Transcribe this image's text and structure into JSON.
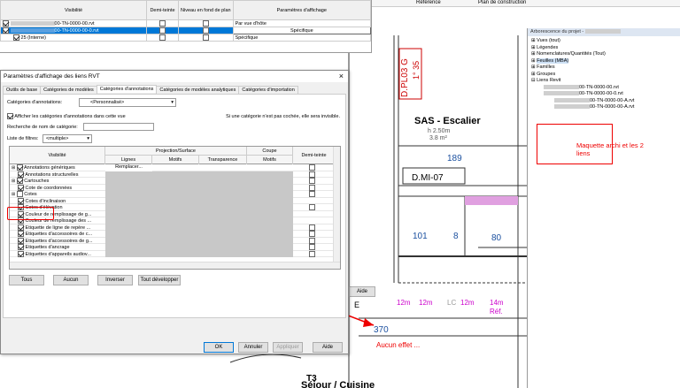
{
  "link_table": {
    "headers": [
      "Visibilité",
      "Demi-teinte",
      "Niveau en fond de plan",
      "Paramètres d'affichage"
    ],
    "rows": [
      {
        "name": "00-TN-0000-00.rvt",
        "setting": "Par vue d'hôte",
        "selected": false,
        "checked": true
      },
      {
        "name": "00-TN-0000-00-0.rvt",
        "setting": "Spécifique",
        "selected": true,
        "checked": true
      },
      {
        "name": "25 (Interne)",
        "setting": "Spécifique",
        "selected": false,
        "checked": true
      }
    ]
  },
  "ribbon": {
    "ref": "Référence",
    "plan": "Plan de construction"
  },
  "browser": {
    "title": "Arborescence du projet -",
    "items": [
      "Vues (tout)",
      "Légendes",
      "Nomenclatures/Quantités (Tout)",
      "Feuilles (MBA)",
      "Familles",
      "Groupes",
      "Liens Revit"
    ],
    "links": [
      "00-TN-0000-00.rvt",
      "00-TN-0000-00-0.rvt",
      "00-TN-0000-00-A.rvt",
      "00-TN-0000-00-A.rvt"
    ]
  },
  "annotation_right": "Maquette archi et les 2 liens",
  "annotation_bottom": "Aucun effet ...",
  "drawing": {
    "room1": "SAS - Escalier",
    "room1_h": "h 2.50m",
    "room1_a": "3.8 m²",
    "n189": "189",
    "dmi": "D.MI-07",
    "n101": "101",
    "n8": "8",
    "n80": "80",
    "dpl": "D.PL03 G",
    "deg": "1° 35",
    "n370": "370",
    "e": "E",
    "d1": "12m",
    "d2": "12m",
    "lc": "LC",
    "d3": "12m",
    "d4": "14m",
    "ref": "Réf.",
    "room2": "Séjour / Cuisine",
    "t3": "T3",
    "aide": "Aide"
  },
  "dialog": {
    "title": "Paramètres d'affichage des liens RVT",
    "close": "×",
    "tabs": [
      "Outils de base",
      "Catégories de modèles",
      "Catégories d'annotations",
      "Catégories de modèles analytiques",
      "Catégories d'importation"
    ],
    "active_tab": 2,
    "cat_label": "Catégories d'annotations:",
    "cat_value": "<Personnalisé>",
    "show_label": "Afficher les catégories d'annotations dans cette vue",
    "hint": "Si une catégorie n'est pas cochée, elle sera invisible.",
    "search_label": "Recherche de nom de catégorie:",
    "filter_label": "Liste de filtres:",
    "filter_value": "<multiple>",
    "col_visibility": "Visibilité",
    "col_proj": "Projection/Surface",
    "col_lines": "Lignes",
    "col_patterns": "Motifs",
    "col_transp": "Transparence",
    "col_cut": "Coupe",
    "col_cutpat": "Motifs",
    "col_half": "Demi-teinte",
    "replace": "Remplacer...",
    "rows": [
      {
        "label": "Annotations génériques",
        "exp": true,
        "on": true,
        "half": true
      },
      {
        "label": "Annotations structurelles",
        "exp": false,
        "on": true,
        "half": true
      },
      {
        "label": "Cartouches",
        "exp": true,
        "on": true,
        "half": true
      },
      {
        "label": "Cote de coordonnées",
        "exp": false,
        "on": true,
        "half": true
      },
      {
        "label": "Cotes",
        "exp": true,
        "on": false,
        "half": true
      },
      {
        "label": "Cotes d'inclinaison",
        "exp": false,
        "on": true,
        "half": false
      },
      {
        "label": "Cotes d'élévation",
        "exp": false,
        "on": true,
        "half": true
      },
      {
        "label": "Couleur de remplissage de g...",
        "exp": false,
        "on": true,
        "half": false
      },
      {
        "label": "Couleur de remplissage des ...",
        "exp": false,
        "on": true,
        "half": false
      },
      {
        "label": "Etiquette de ligne de repère ...",
        "exp": false,
        "on": true,
        "half": true
      },
      {
        "label": "Etiquettes d'accessoires de c...",
        "exp": false,
        "on": true,
        "half": true
      },
      {
        "label": "Etiquettes d'accessoires de g...",
        "exp": false,
        "on": true,
        "half": true
      },
      {
        "label": "Etiquettes d'ancrage",
        "exp": false,
        "on": true,
        "half": true
      },
      {
        "label": "Etiquettes d'appareils audiov...",
        "exp": false,
        "on": true,
        "half": true
      }
    ],
    "buttons": [
      "Tous",
      "Aucun",
      "Inverser",
      "Tout développer"
    ],
    "footer": [
      "OK",
      "Annuler",
      "Appliquer",
      "Aide"
    ]
  }
}
